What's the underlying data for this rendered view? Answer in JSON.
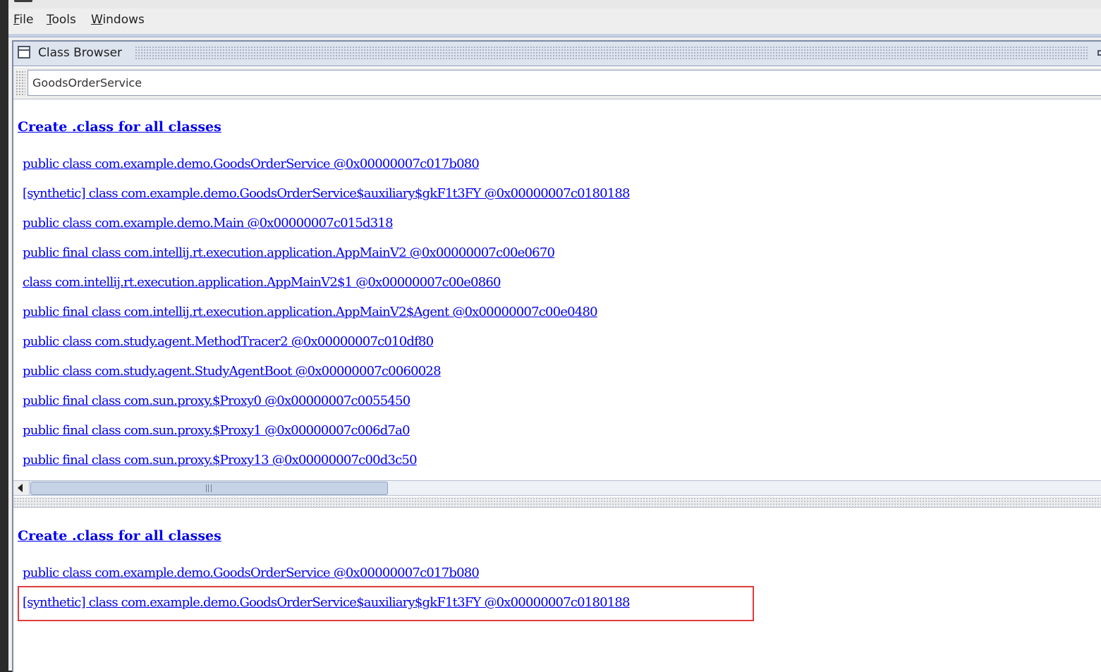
{
  "menubar": {
    "items": [
      "File",
      "Tools",
      "Windows"
    ]
  },
  "window": {
    "title": "Class Browser"
  },
  "search": {
    "value": "GoodsOrderService"
  },
  "top_pane": {
    "create_link": "Create .class for all classes",
    "classes": [
      "public class com.example.demo.GoodsOrderService @0x00000007c017b080",
      "[synthetic] class com.example.demo.GoodsOrderService$auxiliary$gkF1t3FY @0x00000007c0180188",
      "public class com.example.demo.Main @0x00000007c015d318",
      "public final class com.intellij.rt.execution.application.AppMainV2 @0x00000007c00e0670",
      "class com.intellij.rt.execution.application.AppMainV2$1 @0x00000007c00e0860",
      "public final class com.intellij.rt.execution.application.AppMainV2$Agent @0x00000007c00e0480",
      "public class com.study.agent.MethodTracer2 @0x00000007c010df80",
      "public class com.study.agent.StudyAgentBoot @0x00000007c0060028",
      "public final class com.sun.proxy.$Proxy0 @0x00000007c0055450",
      "public final class com.sun.proxy.$Proxy1 @0x00000007c006d7a0",
      "public final class com.sun.proxy.$Proxy13 @0x00000007c00d3c50"
    ]
  },
  "bottom_pane": {
    "create_link": "Create .class for all classes",
    "classes": [
      "public class com.example.demo.GoodsOrderService @0x00000007c017b080",
      "[synthetic] class com.example.demo.GoodsOrderService$auxiliary$gkF1t3FY @0x00000007c0180188"
    ],
    "highlight_color": "#e03b3b"
  },
  "colors": {
    "link": "#0000ee",
    "frame_border": "#7d8ba6",
    "titlebar": "#dde4ee"
  }
}
